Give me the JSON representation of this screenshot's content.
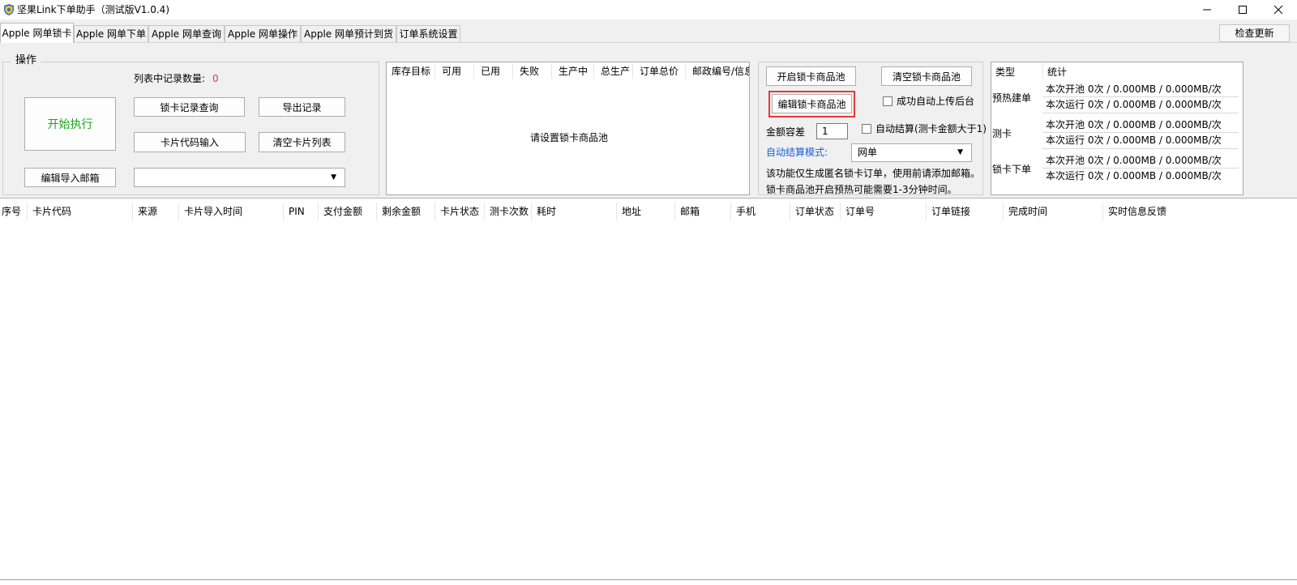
{
  "window": {
    "title": "坚果Link下单助手（测试版V1.0.4)",
    "minimize_icon": "minimize-icon",
    "maximize_icon": "maximize-icon",
    "close_icon": "close-icon"
  },
  "tabs": [
    {
      "label": "Apple 网单锁卡",
      "active": true
    },
    {
      "label": "Apple 网单下单"
    },
    {
      "label": "Apple 网单查询"
    },
    {
      "label": "Apple 网单操作"
    },
    {
      "label": "Apple 网单预计到货"
    },
    {
      "label": "订单系统设置"
    }
  ],
  "check_update": "检查更新",
  "ops": {
    "legend": "操作",
    "record_count_label": "列表中记录数量:",
    "record_count_value": "0",
    "start_button": "开始执行",
    "lock_record_query": "锁卡记录查询",
    "export_records": "导出记录",
    "card_code_input": "卡片代码输入",
    "clear_card_list": "清空卡片列表",
    "edit_import_email": "编辑导入邮箱",
    "email_select_value": ""
  },
  "pool_list": {
    "headers": [
      "库存目标",
      "可用",
      "已用",
      "失败",
      "生产中",
      "总生产",
      "订单总价",
      "邮政编号/信息"
    ],
    "empty_message": "请设置锁卡商品池"
  },
  "pool_panel": {
    "open_pool": "开启锁卡商品池",
    "clear_pool": "清空锁卡商品池",
    "edit_pool": "编辑锁卡商品池",
    "auto_upload_label": "成功自动上传后台",
    "tolerance_label": "金额容差",
    "tolerance_value": "1",
    "auto_settle_label": "自动结算(测卡金额大于1)",
    "auto_settle_mode_label": "自动结算模式:",
    "auto_settle_mode_value": "网单",
    "note_line1": "该功能仅生成匿名锁卡订单，使用前请添加邮箱。",
    "note_line2": "锁卡商品池开启预热可能需要1-3分钟时间。"
  },
  "stats": {
    "header_type": "类型",
    "header_stats": "统计",
    "groups": [
      {
        "type": "预热建单",
        "rows": [
          "本次开池  0次 / 0.000MB / 0.000MB/次",
          "本次运行  0次 / 0.000MB / 0.000MB/次"
        ]
      },
      {
        "type": "测卡",
        "rows": [
          "本次开池  0次 / 0.000MB / 0.000MB/次",
          "本次运行  0次 / 0.000MB / 0.000MB/次"
        ]
      },
      {
        "type": "锁卡下单",
        "rows": [
          "本次开池  0次 / 0.000MB / 0.000MB/次",
          "本次运行  0次 / 0.000MB / 0.000MB/次"
        ]
      }
    ]
  },
  "grid": {
    "headers": [
      "序号",
      "卡片代码",
      "来源",
      "卡片导入时间",
      "PIN",
      "支付金额",
      "剩余金额",
      "卡片状态",
      "测卡次数",
      "耗时",
      "地址",
      "邮箱",
      "手机",
      "订单状态",
      "订单号",
      "订单链接",
      "完成时间",
      "实时信息反馈"
    ]
  },
  "colors": {
    "start_text": "#1fa31f",
    "count_value": "#e53935",
    "link_label": "#1a5fd6",
    "highlight": "#e53935"
  }
}
